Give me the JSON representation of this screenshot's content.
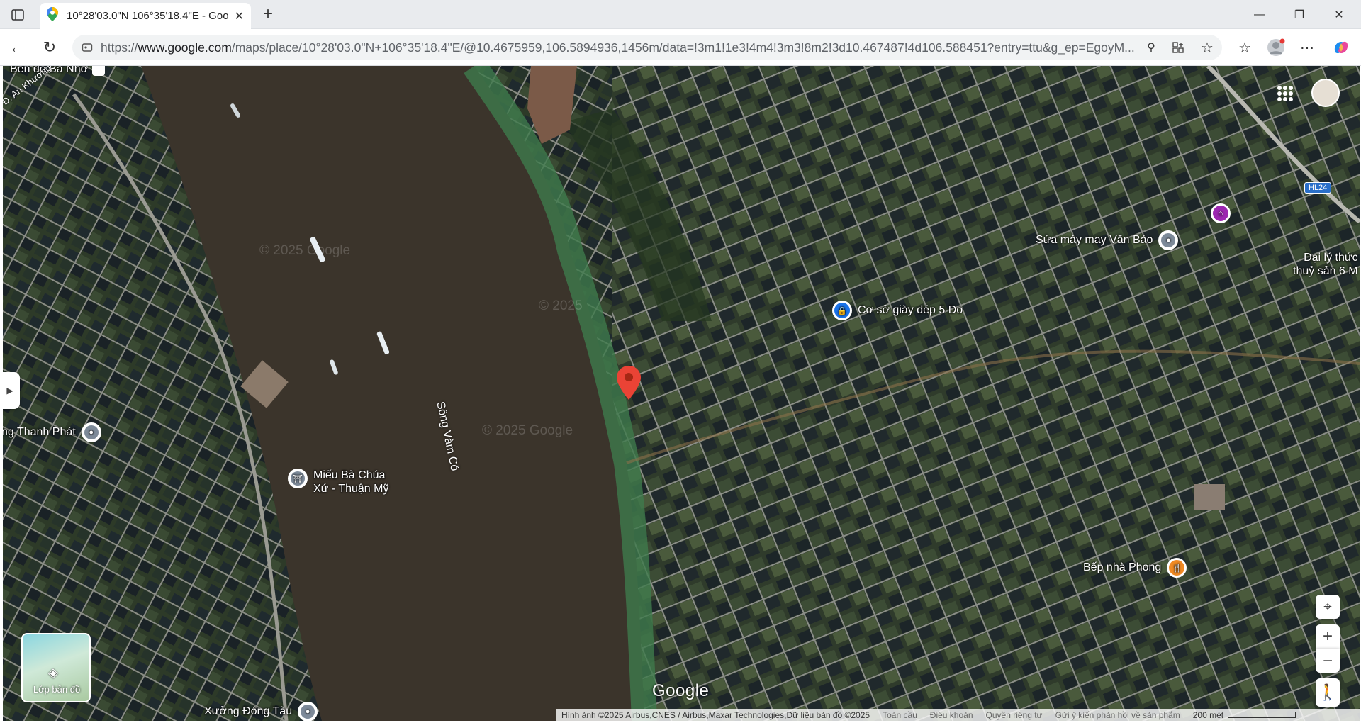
{
  "tab": {
    "title": "10°28'03.0\"N 106°35'18.4\"E - Goo",
    "favicon": "google-maps-pin-icon"
  },
  "address": {
    "prefix": "https://",
    "domain": "www.google.com",
    "path": "/maps/place/10°28'03.0\"N+106°35'18.4\"E/@10.4675959,106.5894936,1456m/data=!3m1!1e3!4m4!3m3!8m2!3d10.467487!4d106.588451?entry=ttu&g_ep=EgoyM..."
  },
  "map": {
    "labels": {
      "ben_do": "Bến đò Bà Nhờ",
      "an_khuong_thoi": "Đ. An Khương Thới",
      "river": "Sông Vàm Cỏ",
      "thanh_phat": "ng Thanh Phát",
      "xuong_dong_tau": "Xưởng Đóng Tàu",
      "mieu_ba_chua": "Miếu Bà Chúa\nXứ - Thuận Mỹ",
      "giay_dep": "Cơ sở giày dép 5 Do",
      "sua_may": "Sửa máy may Văn Bảo",
      "dai_ly": "Đại lý thức\nthuỷ sản 6 M",
      "bep_nha": "Bếp nhà Phong",
      "road_shield": "HL24",
      "watermark1": "© 2025 Google",
      "watermark2": "© 2025",
      "watermark3": "© 2025 Google"
    },
    "layers_label": "Lớp bản đồ",
    "google_logo": "Google",
    "footer": {
      "imagery": "Hình ảnh ©2025 Airbus,CNES / Airbus,Maxar Technologies,Dữ liệu bản đồ ©2025",
      "global": "Toàn cầu",
      "terms": "Điều khoản",
      "privacy": "Quyền riêng tư",
      "feedback": "Gửi ý kiến phản hồi về sản phẩm",
      "scale": "200 mét"
    }
  }
}
